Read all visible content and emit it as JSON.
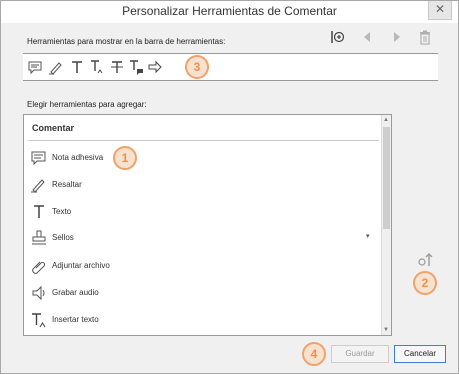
{
  "window": {
    "title": "Personalizar Herramientas de Comentar",
    "close_icon": "close-icon"
  },
  "toolbar_section": {
    "label": "Herramientas para mostrar en la barra de herramientas:",
    "controls": [
      {
        "name": "add-separator-icon"
      },
      {
        "name": "move-left-icon"
      },
      {
        "name": "move-right-icon"
      },
      {
        "name": "trash-icon"
      }
    ],
    "selected_tools": [
      {
        "name": "sticky-note-icon"
      },
      {
        "name": "highlight-pen-icon"
      },
      {
        "name": "text-icon"
      },
      {
        "name": "insert-text-icon"
      },
      {
        "name": "strikethrough-text-icon"
      },
      {
        "name": "replace-text-icon"
      },
      {
        "name": "arrow-icon"
      }
    ]
  },
  "add_section": {
    "label": "Elegir herramientas para agregar:",
    "group_header": "Comentar",
    "items": [
      {
        "label": "Nota adhesiva",
        "icon": "sticky-note-icon"
      },
      {
        "label": "Resaltar",
        "icon": "highlight-pen-icon"
      },
      {
        "label": "Texto",
        "icon": "text-icon"
      },
      {
        "label": "Sellos",
        "icon": "stamp-icon"
      },
      {
        "label": "Adjuntar archivo",
        "icon": "paperclip-icon"
      },
      {
        "label": "Grabar audio",
        "icon": "speaker-icon"
      },
      {
        "label": "Insertar texto",
        "icon": "insert-text-icon"
      }
    ]
  },
  "side_control": {
    "name": "move-up-icon"
  },
  "badges": [
    "1",
    "2",
    "3",
    "4"
  ],
  "buttons": {
    "save": "Guardar",
    "cancel": "Cancelar"
  },
  "colors": {
    "badge_orange": "#f09050",
    "primary_border": "#3f7fd1"
  }
}
